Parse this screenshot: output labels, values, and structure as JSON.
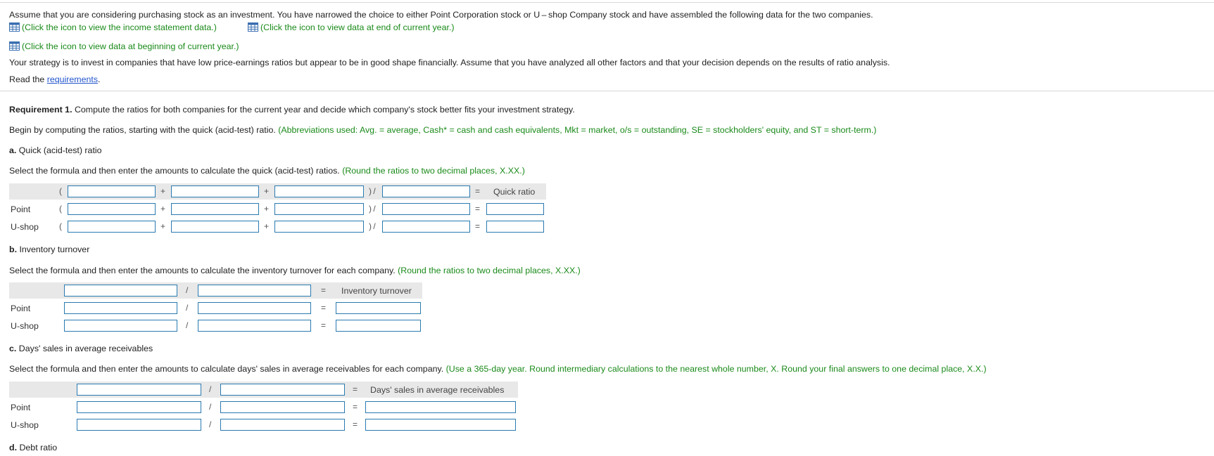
{
  "intro": {
    "line1": "Assume that you are considering purchasing stock as an investment. You have narrowed the choice to either Point Corporation stock or U – shop Company stock and have assembled the following data for the two companies.",
    "link_income": "(Click the icon to view the income statement data.)",
    "link_end": "(Click the icon to view data at end of current year.)",
    "link_begin": "(Click the icon to view data at beginning of current year.)",
    "strategy": "Your strategy is to invest in companies that have low price-earnings ratios but appear to be in good shape financially. Assume that you have analyzed all other factors and that your decision depends on the results of ratio analysis.",
    "read_prefix": "Read the ",
    "read_link": "requirements",
    "read_suffix": "."
  },
  "req1": {
    "label": "Requirement 1.",
    "text": " Compute the ratios for both companies for the current year and decide which company's stock better fits your investment strategy.",
    "begin": "Begin by computing the ratios, starting with the quick (acid-test) ratio.",
    "abbrev": "(Abbreviations used: Avg. = average, Cash* = cash and cash equivalents, Mkt = market, o/s = outstanding, SE = stockholders' equity, and ST = short-term.)"
  },
  "sections": {
    "a": {
      "label": "a.",
      "title": " Quick (acid-test) ratio",
      "instruction": "Select the formula and then enter the amounts to calculate the quick (acid-test) ratios.",
      "note": "(Round the ratios to two decimal places, X.XX.)",
      "result_label": "Quick ratio",
      "ops": {
        "open": "(",
        "plus": "+",
        "close_div": ") /",
        "eq": "="
      }
    },
    "b": {
      "label": "b.",
      "title": " Inventory turnover",
      "instruction": "Select the formula and then enter the amounts to calculate the inventory turnover for each company.",
      "note": "(Round the ratios to two decimal places, X.XX.)",
      "result_label": "Inventory turnover",
      "ops": {
        "div": "/",
        "eq": "="
      }
    },
    "c": {
      "label": "c.",
      "title": " Days' sales in average receivables",
      "instruction": "Select the formula and then enter the amounts to calculate days' sales in average receivables for each company.",
      "note": "(Use a 365-day year. Round intermediary calculations to the nearest whole number, X. Round your final answers to one decimal place, X.X.)",
      "result_label": "Days' sales in average receivables",
      "ops": {
        "div": "/",
        "eq": "="
      }
    },
    "d": {
      "label": "d.",
      "title": " Debt ratio"
    }
  },
  "companies": {
    "point": "Point",
    "ushop": "U-shop"
  },
  "colors": {
    "accent_green": "#1a8a1a",
    "link_blue": "#2255cc",
    "input_border": "#2a7ab0",
    "header_bg": "#e8e8e8"
  },
  "icons": {
    "table": "table-grid-icon"
  }
}
